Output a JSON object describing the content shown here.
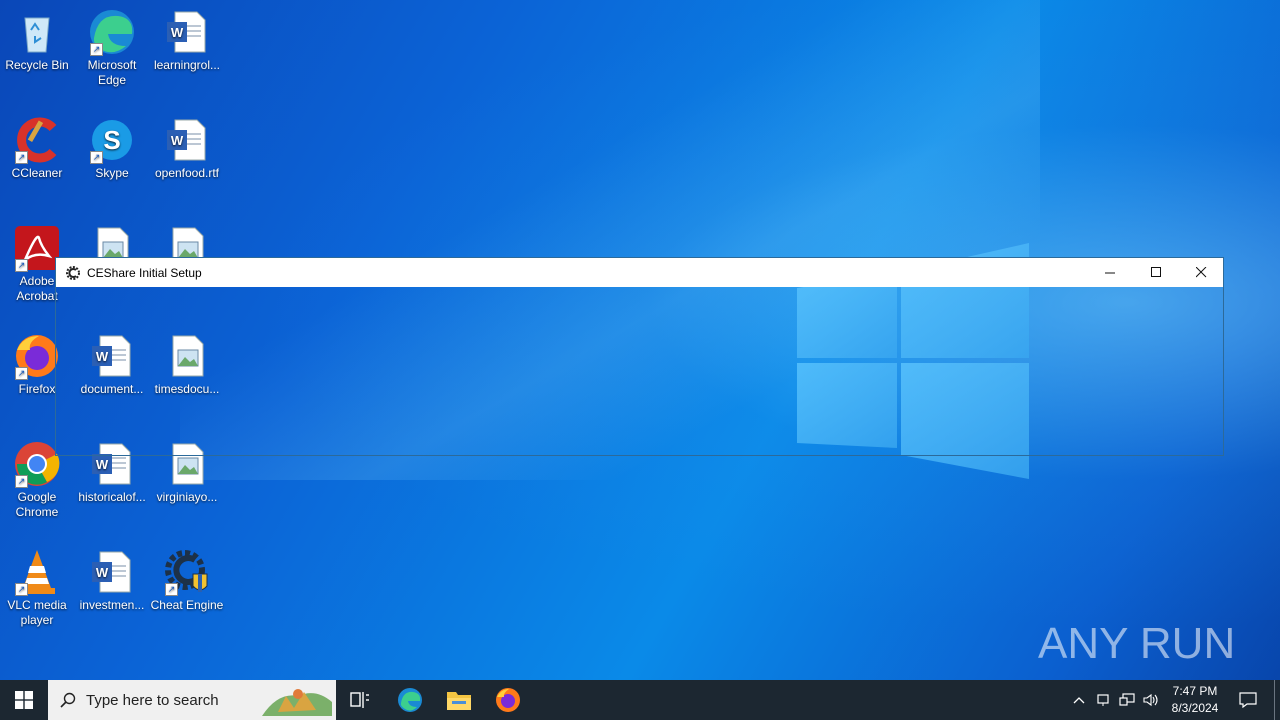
{
  "desktop": {
    "icons": [
      {
        "label": "Recycle Bin",
        "icon": "recycle-bin-icon"
      },
      {
        "label": "Microsoft Edge",
        "icon": "edge-icon"
      },
      {
        "label": "learningrol...",
        "icon": "word-doc-icon"
      },
      {
        "label": "CCleaner",
        "icon": "ccleaner-icon"
      },
      {
        "label": "Skype",
        "icon": "skype-icon"
      },
      {
        "label": "openfood.rtf",
        "icon": "word-doc-icon"
      },
      {
        "label": "Adobe Acrobat",
        "icon": "acrobat-icon"
      },
      {
        "label": "",
        "icon": "image-file-icon"
      },
      {
        "label": "",
        "icon": "image-file-icon"
      },
      {
        "label": "Firefox",
        "icon": "firefox-icon"
      },
      {
        "label": "document...",
        "icon": "word-doc-icon"
      },
      {
        "label": "timesdocu...",
        "icon": "image-file-icon"
      },
      {
        "label": "Google Chrome",
        "icon": "chrome-icon"
      },
      {
        "label": "historicalof...",
        "icon": "word-doc-icon"
      },
      {
        "label": "virginiayo...",
        "icon": "image-file-icon"
      },
      {
        "label": "VLC media player",
        "icon": "vlc-icon"
      },
      {
        "label": "investmen...",
        "icon": "word-doc-icon"
      },
      {
        "label": "Cheat Engine",
        "icon": "cheat-engine-icon"
      }
    ]
  },
  "window": {
    "title": "CEShare Initial Setup",
    "minimize": "minimize-icon",
    "maximize": "maximize-icon",
    "close": "close-icon"
  },
  "watermark": {
    "text": "ANY RUN"
  },
  "taskbar": {
    "search_placeholder": "Type here to search",
    "apps": [
      "task-view-icon",
      "edge-icon",
      "file-explorer-icon",
      "firefox-icon"
    ],
    "tray": [
      "chevron-up-icon",
      "network-icon",
      "network-icon",
      "volume-icon"
    ],
    "time": "7:47 PM",
    "date": "8/3/2024",
    "notification": "notification-icon"
  },
  "colors": {
    "desktop_blue": "#0b63d6",
    "taskbar": "#1c2731",
    "window_border": "#2c6a9a"
  }
}
